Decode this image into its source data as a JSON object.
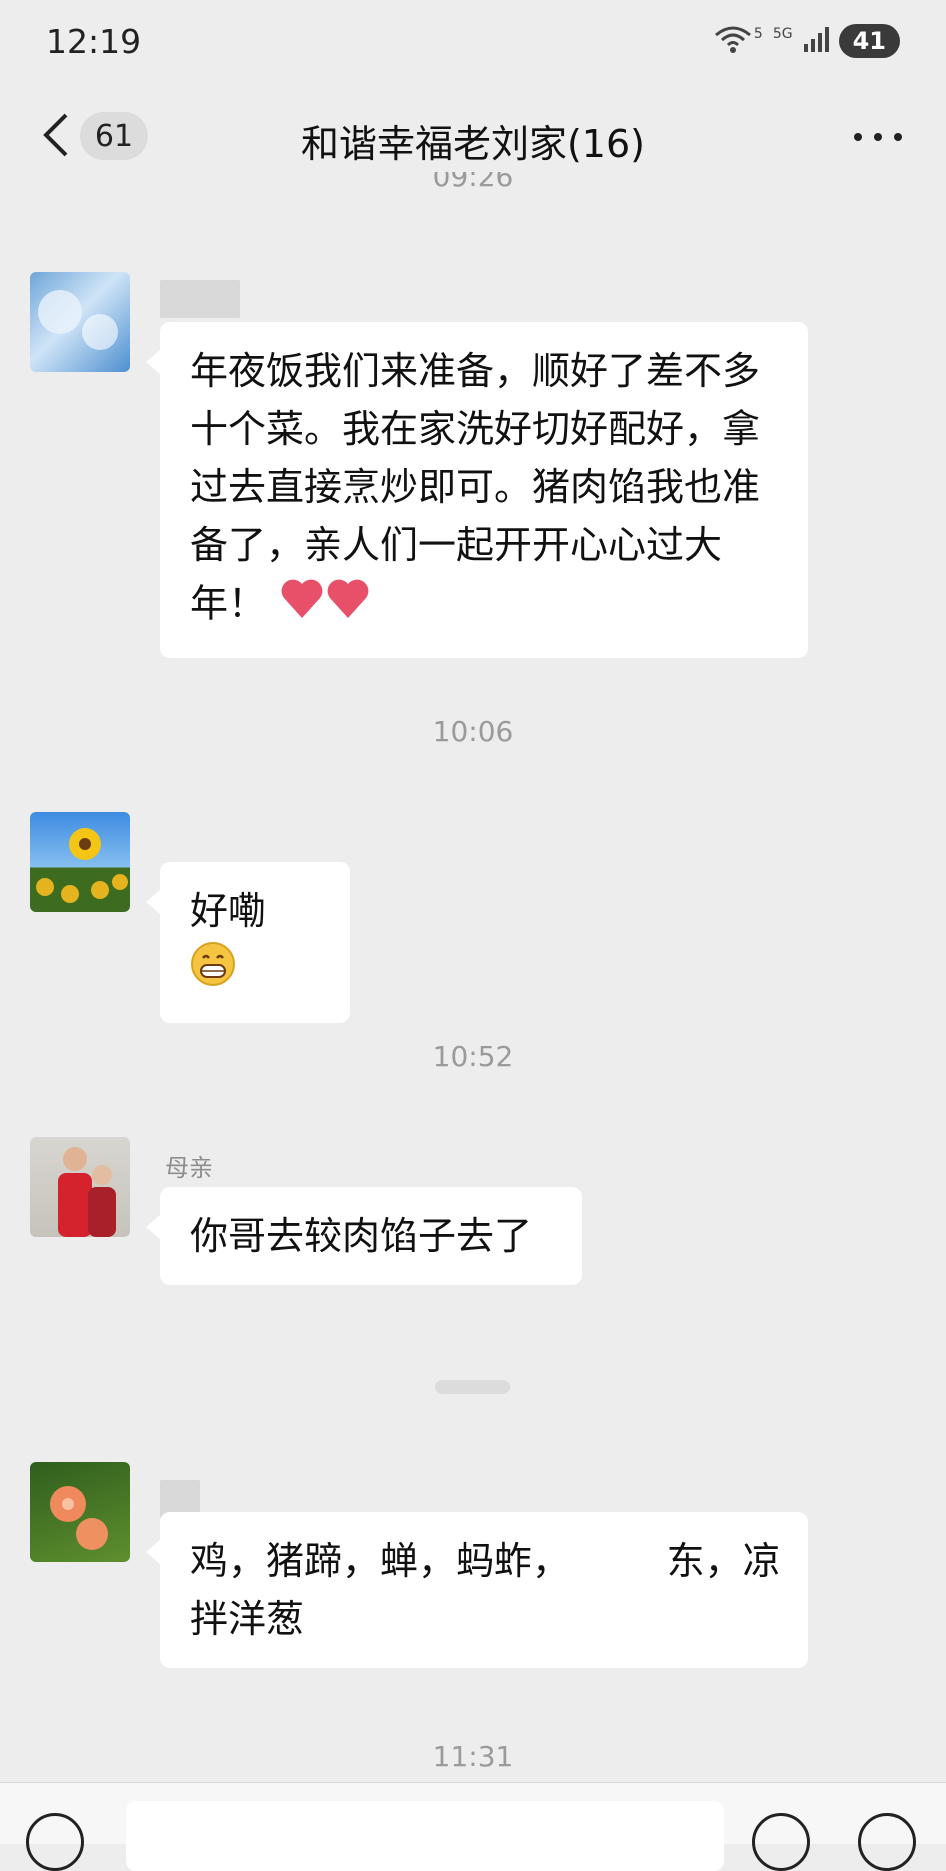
{
  "status_bar": {
    "time": "12:19",
    "network_label": "5G",
    "wifi_label": "5",
    "battery": "41"
  },
  "header": {
    "unread_count": "61",
    "title": "和谐幸福老刘家(16)"
  },
  "timestamps": {
    "top_partial": "09:26",
    "t1": "10:06",
    "t2": "10:52",
    "t3": "11:31"
  },
  "messages": [
    {
      "sender": "",
      "lines": [
        "年夜饭我们来准备，顺好了差不多",
        "十个菜。我在家洗好切好配好，拿",
        "过去直接烹炒即可。猪肉馅我也准",
        "备了，亲人们一起开开心心过大",
        "年！"
      ],
      "emoji": "two-hearts"
    },
    {
      "sender": "",
      "text": "好嘞",
      "emoji": "grin-face"
    },
    {
      "sender": "母亲",
      "text": "你哥去较肉馅子去了"
    },
    {
      "sender": "",
      "lines": [
        "鸡，猪蹄，蝉，蚂蚱，        东，凉",
        "拌洋葱"
      ]
    }
  ],
  "colors": {
    "background": "#ededed",
    "bubble": "#ffffff",
    "heart": "#e8506a",
    "emoji_face": "#f5c542"
  },
  "icons": [
    "back-icon",
    "more-icon",
    "wifi-icon",
    "signal-icon",
    "battery-icon",
    "voice-icon",
    "emoji-icon",
    "plus-icon"
  ]
}
